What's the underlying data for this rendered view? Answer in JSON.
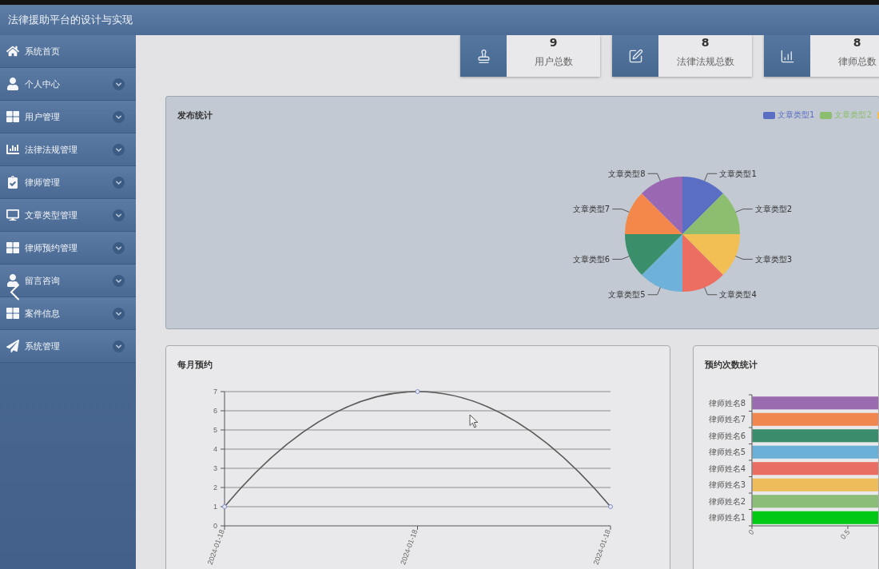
{
  "header": {
    "title": "法律援助平台的设计与实现"
  },
  "sidebar": {
    "items": [
      {
        "label": "系统首页",
        "has_submenu": false
      },
      {
        "label": "个人中心",
        "has_submenu": true
      },
      {
        "label": "用户管理",
        "has_submenu": true
      },
      {
        "label": "法律法规管理",
        "has_submenu": true
      },
      {
        "label": "律师管理",
        "has_submenu": true
      },
      {
        "label": "文章类型管理",
        "has_submenu": true
      },
      {
        "label": "律师预约管理",
        "has_submenu": true
      },
      {
        "label": "留言咨询",
        "has_submenu": true
      },
      {
        "label": "案件信息",
        "has_submenu": true
      },
      {
        "label": "系统管理",
        "has_submenu": true
      }
    ]
  },
  "stats": [
    {
      "value": "9",
      "label": "用户总数"
    },
    {
      "value": "8",
      "label": "法律法规总数"
    },
    {
      "value": "8",
      "label": "律师总数"
    }
  ],
  "publish_panel": {
    "title": "发布统计",
    "legend": [
      {
        "label": "文章类型1",
        "color": "#5a6fc4"
      },
      {
        "label": "文章类型2",
        "color": "#8dbd6f"
      },
      {
        "color": "#f2bf55"
      }
    ],
    "chart_data": {
      "type": "pie",
      "categories": [
        "文章类型1",
        "文章类型2",
        "文章类型3",
        "文章类型4",
        "文章类型5",
        "文章类型6",
        "文章类型7",
        "文章类型8"
      ],
      "values": [
        1,
        1,
        1,
        1,
        1,
        1,
        1,
        1
      ]
    }
  },
  "appointments_panel": {
    "title": "每月预约",
    "chart_data": {
      "type": "line",
      "categories": [
        "2024-01-18",
        "2024-01-18",
        "2024-01-18"
      ],
      "series": [
        {
          "values": [
            1,
            7,
            1
          ],
          "marker": "circle"
        }
      ],
      "ylim": [
        0,
        7
      ],
      "yticks": [
        0,
        1,
        2,
        3,
        4,
        5,
        6,
        7
      ],
      "grid": true
    }
  },
  "bookings_panel": {
    "title": "预约次数统计",
    "bars": [
      {
        "label": "律师姓名8",
        "color": "#9b6bb0"
      },
      {
        "label": "律师姓名7",
        "color": "#f0874f"
      },
      {
        "label": "律师姓名6",
        "color": "#3a8c6c"
      },
      {
        "label": "律师姓名5",
        "color": "#6aafd6"
      },
      {
        "label": "律师姓名4",
        "color": "#e86d62"
      },
      {
        "label": "律师姓名3",
        "color": "#eebc5a"
      },
      {
        "label": "律师姓名2",
        "color": "#8cbd78"
      },
      {
        "label": "律师姓名1",
        "color": "#00c814"
      }
    ],
    "x_axis_labels": [
      "0",
      "0.5"
    ]
  }
}
